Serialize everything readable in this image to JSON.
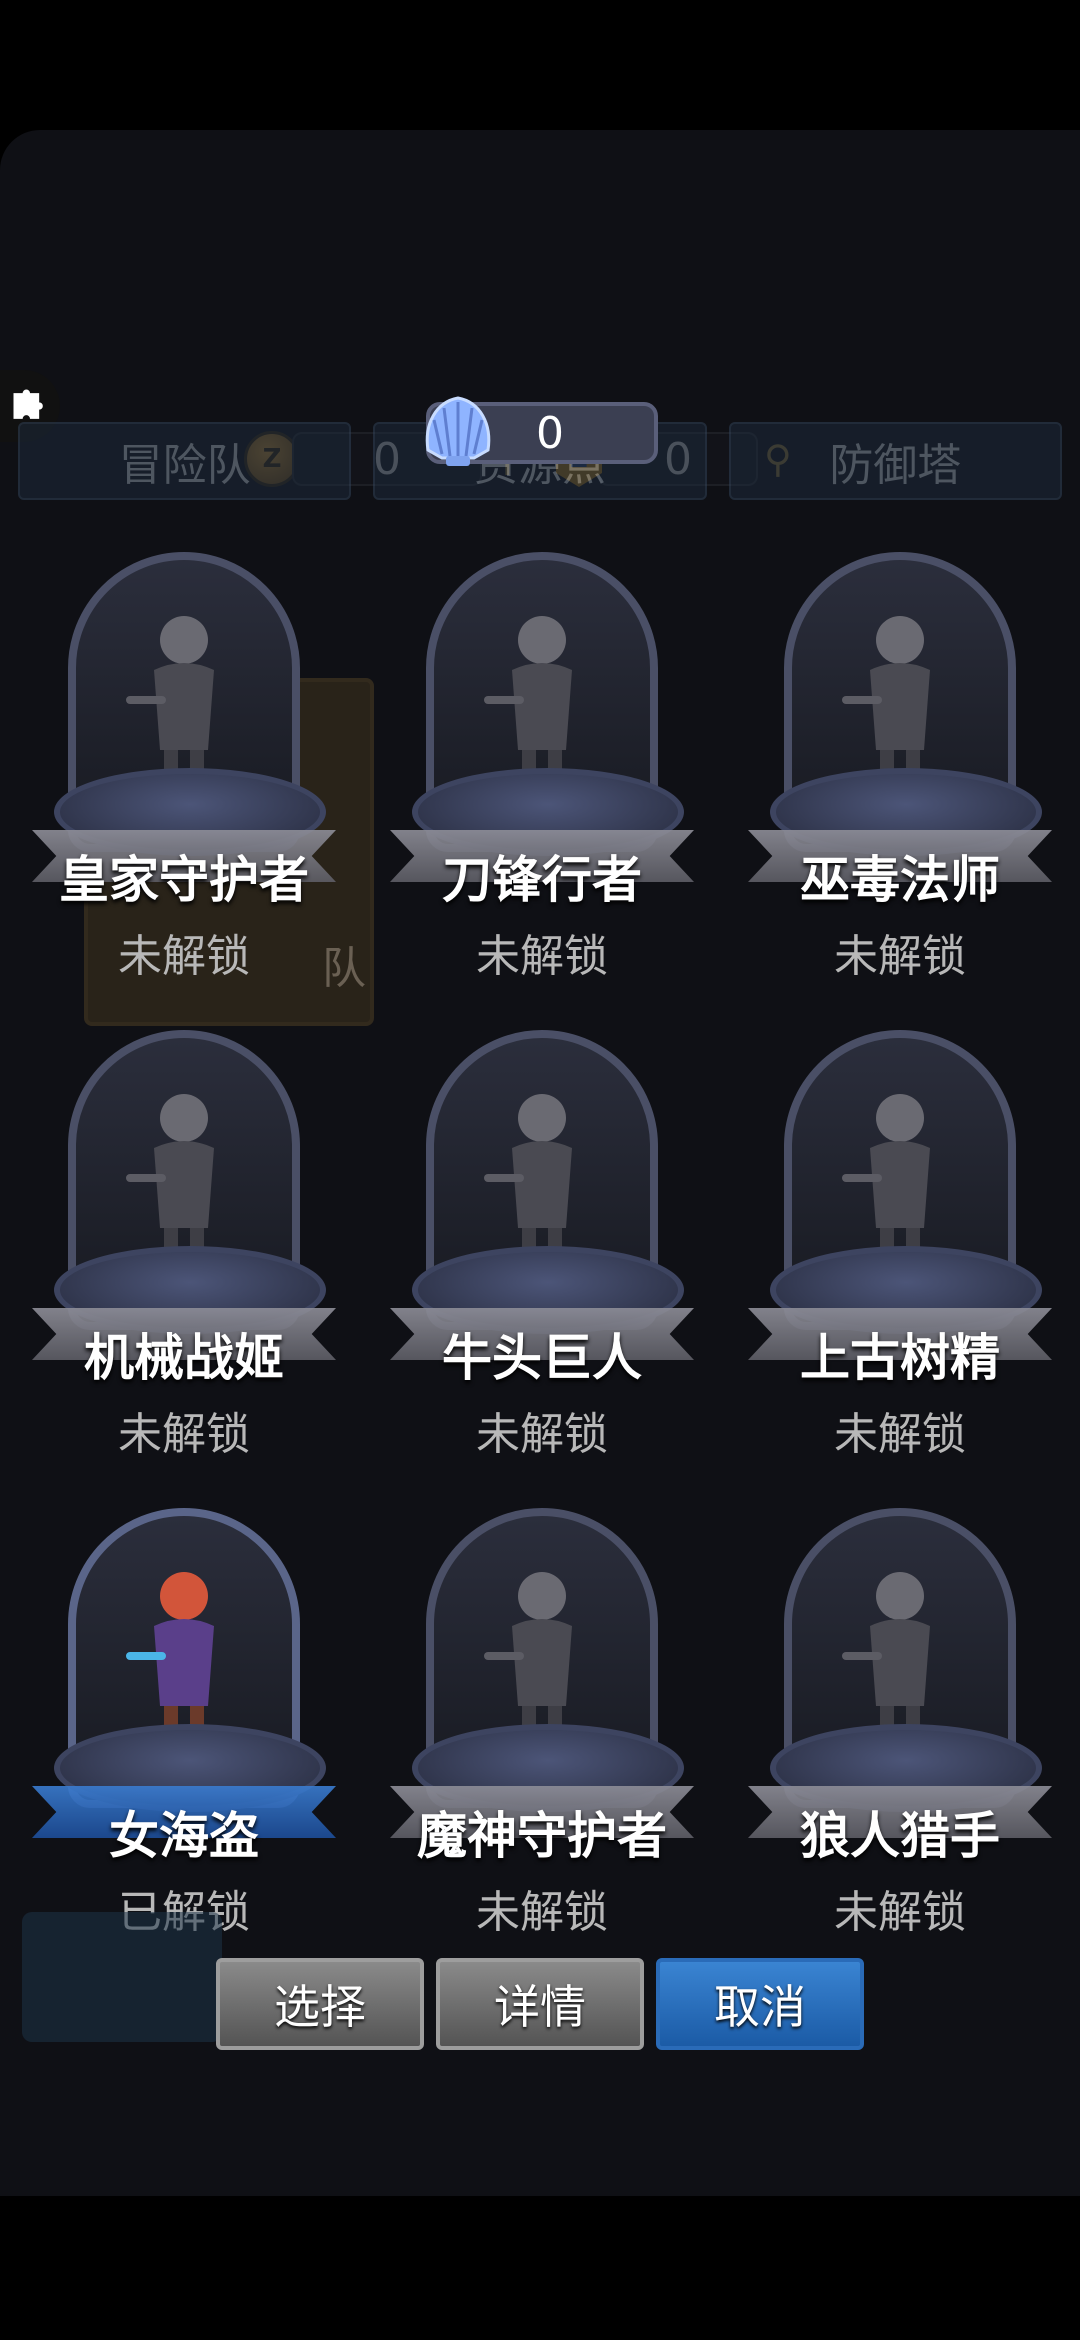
{
  "currency": {
    "coin_value": "0",
    "badge_value": "0",
    "badge_letter": "Z",
    "coin_letter": "Z"
  },
  "shell": {
    "value": "0"
  },
  "tabs": [
    "冒险队",
    "资源点",
    "防御塔"
  ],
  "background_label": "队",
  "heroes": [
    {
      "name": "皇家守护者",
      "status": "未解锁",
      "unlocked": false
    },
    {
      "name": "刀锋行者",
      "status": "未解锁",
      "unlocked": false
    },
    {
      "name": "巫毒法师",
      "status": "未解锁",
      "unlocked": false
    },
    {
      "name": "机械战姬",
      "status": "未解锁",
      "unlocked": false
    },
    {
      "name": "牛头巨人",
      "status": "未解锁",
      "unlocked": false
    },
    {
      "name": "上古树精",
      "status": "未解锁",
      "unlocked": false
    },
    {
      "name": "女海盗",
      "status": "已解锁",
      "unlocked": true
    },
    {
      "name": "魔神守护者",
      "status": "未解锁",
      "unlocked": false
    },
    {
      "name": "狼人猎手",
      "status": "未解锁",
      "unlocked": false
    }
  ],
  "buttons": {
    "select": "选择",
    "details": "详情",
    "cancel": "取消"
  },
  "colors": {
    "accent_blue": "#2a6bb8",
    "background": "#0f1015"
  }
}
